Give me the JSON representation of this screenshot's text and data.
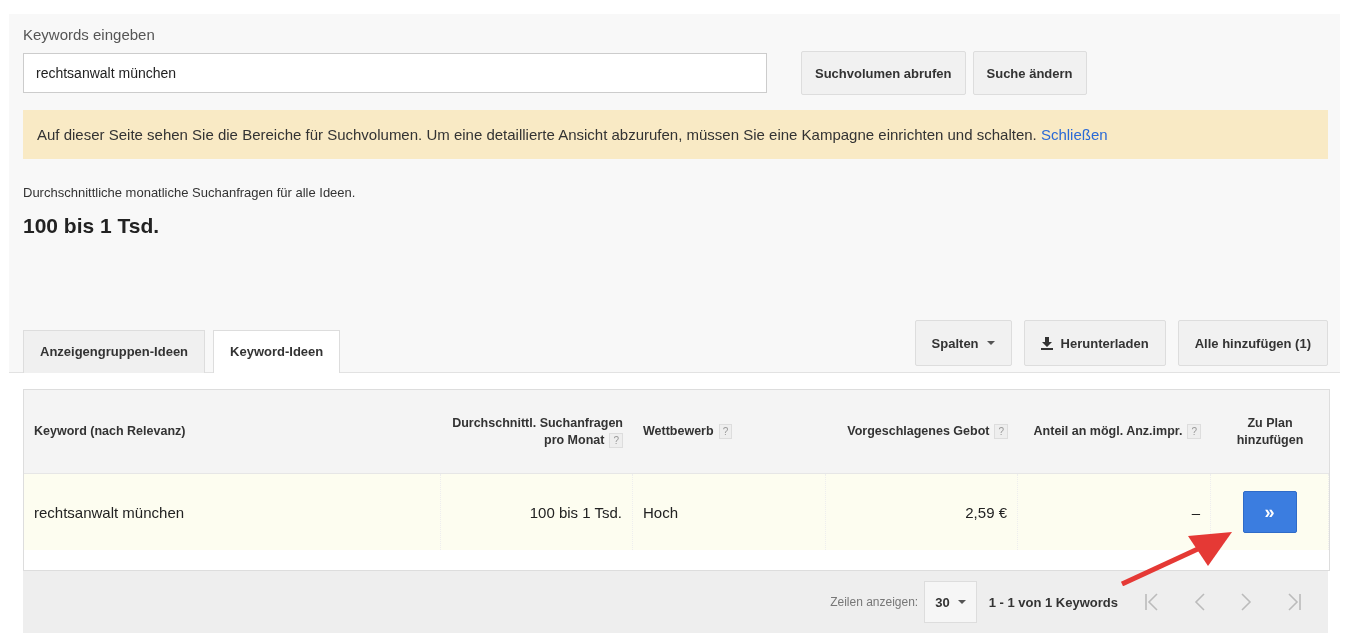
{
  "search": {
    "label": "Keywords eingeben",
    "value": "rechtsanwalt münchen",
    "buttons": [
      "Suchvolumen abrufen",
      "Suche ändern"
    ]
  },
  "notice": {
    "text": "Auf dieser Seite sehen Sie die Bereiche für Suchvolumen. Um eine detaillierte Ansicht abzurufen, müssen Sie eine Kampagne einrichten und schalten.",
    "link": "Schließen"
  },
  "summary": {
    "caption": "Durchschnittliche monatliche Suchanfragen für alle Ideen.",
    "value": "100 bis 1 Tsd."
  },
  "tabs": [
    {
      "label": "Anzeigengruppen-Ideen",
      "selected": false
    },
    {
      "label": "Keyword-Ideen",
      "selected": true
    }
  ],
  "toolbar": [
    {
      "kind": "dropdown",
      "label": "Spalten"
    },
    {
      "kind": "download",
      "label": "Herunterladen"
    },
    {
      "kind": "plain",
      "label": "Alle hinzufügen (1)"
    }
  ],
  "table": {
    "columns": [
      {
        "label": "Keyword (nach Relevanz)"
      },
      {
        "label": "Durchschnittl. Suchanfragen pro Monat",
        "help": "?"
      },
      {
        "label": "Wettbewerb",
        "help": "?"
      },
      {
        "label": "Vorgeschlagenes Gebot",
        "help": "?"
      },
      {
        "label": "Anteil an mögl. Anz.impr.",
        "help": "?"
      },
      {
        "label": "Zu Plan hinzufügen"
      }
    ],
    "rows": [
      {
        "cells": [
          "rechtsanwalt münchen",
          "100 bis 1 Tsd.",
          "Hoch",
          "2,59 €",
          "–"
        ],
        "add_button": "»"
      }
    ]
  },
  "pagination": {
    "rows_label": "Zeilen anzeigen:",
    "rows_value": "30",
    "range": "1 - 1 von 1 Keywords"
  }
}
